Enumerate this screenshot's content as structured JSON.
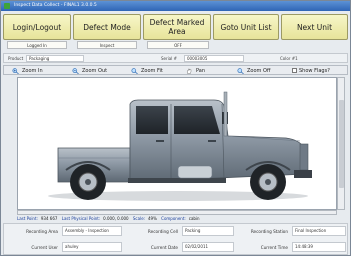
{
  "window": {
    "title": "Inspect Data Collect - FINAL1 3.0.0.5"
  },
  "buttons": {
    "login": "Login/Logout",
    "defect_mode": "Defect Mode",
    "defect_marked_area": "Defect Marked Area",
    "goto_unit_list": "Goto Unit List",
    "next_unit": "Next Unit"
  },
  "status": {
    "login_state": "Logged In",
    "mode_state": "Inspect",
    "defect_area_state": "OFF"
  },
  "info": {
    "product_label": "Product",
    "product_value": "Packaging",
    "serial_label": "Serial #",
    "serial_value": "00003005",
    "color_label": "Color #1"
  },
  "toolbar": {
    "zoom_in": "Zoom In",
    "zoom_out": "Zoom Out",
    "zoom_fit": "Zoom Fit",
    "pan": "Pan",
    "zoom_off": "Zoom Off",
    "show_flags": "Show Flags?"
  },
  "statusline": {
    "last_point_label": "Last Point:",
    "last_point_value": "934 667",
    "last_physical_label": "Last Physical Point:",
    "last_physical_value": "0.000, 0.000",
    "scale_label": "Scale:",
    "scale_value": "49%",
    "component_label": "Component:",
    "component_value": "cabin"
  },
  "bottom": {
    "recording_area_label": "Recording Area",
    "recording_area_value": "Assembly - Inspection",
    "recording_cell_label": "Recording Cell",
    "recording_cell_value": "Packing",
    "recording_station_label": "Recording Station",
    "recording_station_value": "Final Inspection",
    "current_user_label": "Current User",
    "current_user_value": "ahuley",
    "current_date_label": "Current Date",
    "current_date_value": "02/02/2011",
    "current_time_label": "Current Time",
    "current_time_value": "14:48:39"
  }
}
